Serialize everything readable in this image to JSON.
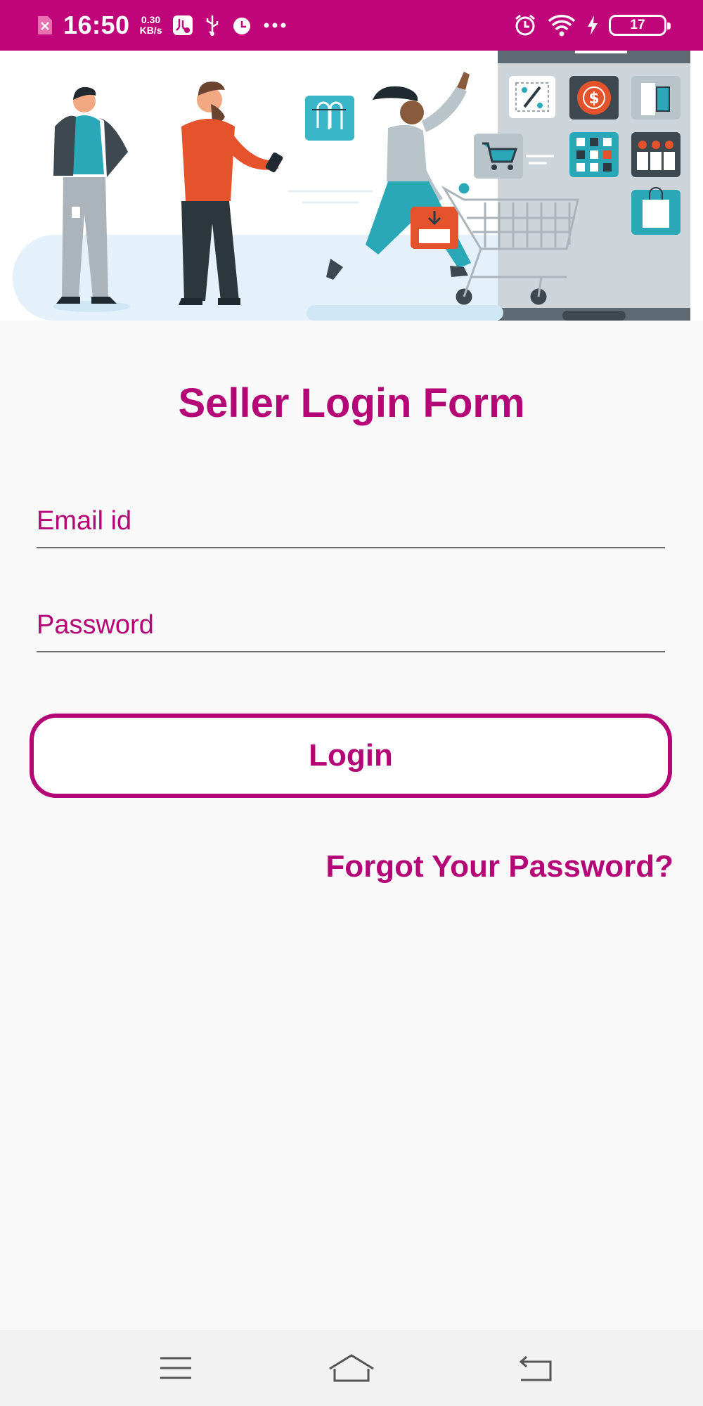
{
  "status_bar": {
    "time": "16:50",
    "net_speed_value": "0.30",
    "net_speed_unit": "KB/s",
    "battery_level": "17",
    "icons": [
      "sim-icon",
      "usb-settings-icon",
      "usb-icon",
      "alarm-icon",
      "more-icon",
      "alarm-icon",
      "wifi-icon",
      "charging-icon",
      "battery-icon"
    ]
  },
  "banner": {
    "description_icons": [
      "shopping-cart-icon",
      "discount-icon",
      "dollar-icon",
      "tag-icon",
      "grid-icon",
      "people-icon",
      "shopping-bag-icon",
      "download-icon",
      "paperclip-icon"
    ]
  },
  "form": {
    "title": "Seller Login Form",
    "email_placeholder": "Email id",
    "password_placeholder": "Password",
    "login_label": "Login",
    "forgot_label": "Forgot Your Password?"
  },
  "nav_bar": {
    "icons": [
      "menu-icon",
      "home-icon",
      "back-icon"
    ]
  },
  "colors": {
    "accent": "#b40677",
    "status_bar": "#c0047a",
    "background": "#f9f9f9"
  }
}
